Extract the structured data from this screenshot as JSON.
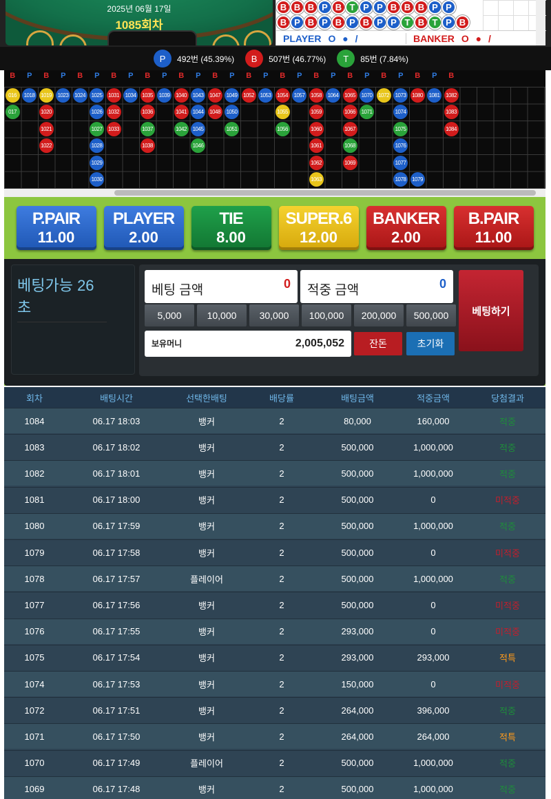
{
  "header": {
    "date": "2025년 06월 17일",
    "round": "1085회차"
  },
  "bead_road": {
    "row1": [
      "B",
      "B",
      "B",
      "P",
      "B",
      "T",
      "P",
      "P",
      "B",
      "B",
      "B",
      "P",
      "P"
    ],
    "row2": [
      "B",
      "P",
      "B",
      "P",
      "B",
      "P",
      "B",
      "P",
      "P",
      "T",
      "B",
      "T",
      "P",
      "B"
    ],
    "player_label": "PLAYER",
    "banker_label": "BANKER",
    "player_symbols": "O ● /",
    "banker_symbols": "O ● /"
  },
  "stats": {
    "player": {
      "icon": "P",
      "text": "492번 (45.39%)"
    },
    "banker": {
      "icon": "B",
      "text": "507번 (46.77%)"
    },
    "tie": {
      "icon": "T",
      "text": "85번 (7.84%)"
    }
  },
  "roadmap": {
    "header": [
      "B",
      "P",
      "B",
      "P",
      "B",
      "P",
      "B",
      "P",
      "B",
      "P",
      "B",
      "P",
      "B",
      "P",
      "B",
      "P",
      "B",
      "P",
      "B",
      "P",
      "B",
      "P",
      "B",
      "P",
      "B",
      "P",
      "B"
    ],
    "cells": [
      {
        "c": 0,
        "r": 0,
        "t": "Y",
        "n": "016"
      },
      {
        "c": 1,
        "r": 0,
        "t": "P",
        "n": "1018"
      },
      {
        "c": 2,
        "r": 0,
        "t": "Y",
        "n": "1019"
      },
      {
        "c": 3,
        "r": 0,
        "t": "P",
        "n": "1023"
      },
      {
        "c": 4,
        "r": 0,
        "t": "P",
        "n": "1024"
      },
      {
        "c": 5,
        "r": 0,
        "t": "P",
        "n": "1025"
      },
      {
        "c": 6,
        "r": 0,
        "t": "B",
        "n": "1031"
      },
      {
        "c": 7,
        "r": 0,
        "t": "P",
        "n": "1034"
      },
      {
        "c": 8,
        "r": 0,
        "t": "B",
        "n": "1035"
      },
      {
        "c": 9,
        "r": 0,
        "t": "P",
        "n": "1039"
      },
      {
        "c": 10,
        "r": 0,
        "t": "B",
        "n": "1040"
      },
      {
        "c": 11,
        "r": 0,
        "t": "P",
        "n": "1043"
      },
      {
        "c": 12,
        "r": 0,
        "t": "B",
        "n": "1047"
      },
      {
        "c": 13,
        "r": 0,
        "t": "P",
        "n": "1049"
      },
      {
        "c": 14,
        "r": 0,
        "t": "B",
        "n": "1052"
      },
      {
        "c": 15,
        "r": 0,
        "t": "P",
        "n": "1053"
      },
      {
        "c": 16,
        "r": 0,
        "t": "B",
        "n": "1054"
      },
      {
        "c": 17,
        "r": 0,
        "t": "P",
        "n": "1057"
      },
      {
        "c": 18,
        "r": 0,
        "t": "B",
        "n": "1058"
      },
      {
        "c": 19,
        "r": 0,
        "t": "P",
        "n": "1064"
      },
      {
        "c": 20,
        "r": 0,
        "t": "B",
        "n": "1065"
      },
      {
        "c": 21,
        "r": 0,
        "t": "P",
        "n": "1070"
      },
      {
        "c": 22,
        "r": 0,
        "t": "Y",
        "n": "1072"
      },
      {
        "c": 23,
        "r": 0,
        "t": "P",
        "n": "1073"
      },
      {
        "c": 24,
        "r": 0,
        "t": "B",
        "n": "1080"
      },
      {
        "c": 25,
        "r": 0,
        "t": "P",
        "n": "1081"
      },
      {
        "c": 26,
        "r": 0,
        "t": "B",
        "n": "1082"
      },
      {
        "c": 0,
        "r": 1,
        "t": "T",
        "n": "017"
      },
      {
        "c": 2,
        "r": 1,
        "t": "B",
        "n": "1020"
      },
      {
        "c": 5,
        "r": 1,
        "t": "P",
        "n": "1026"
      },
      {
        "c": 6,
        "r": 1,
        "t": "B",
        "n": "1032"
      },
      {
        "c": 8,
        "r": 1,
        "t": "B",
        "n": "1036"
      },
      {
        "c": 10,
        "r": 1,
        "t": "B",
        "n": "1041"
      },
      {
        "c": 11,
        "r": 1,
        "t": "P",
        "n": "1044"
      },
      {
        "c": 12,
        "r": 1,
        "t": "B",
        "n": "1048"
      },
      {
        "c": 13,
        "r": 1,
        "t": "P",
        "n": "1050"
      },
      {
        "c": 16,
        "r": 1,
        "t": "Y",
        "n": "1055"
      },
      {
        "c": 18,
        "r": 1,
        "t": "B",
        "n": "1059"
      },
      {
        "c": 20,
        "r": 1,
        "t": "B",
        "n": "1066"
      },
      {
        "c": 21,
        "r": 1,
        "t": "T",
        "n": "1071"
      },
      {
        "c": 23,
        "r": 1,
        "t": "P",
        "n": "1074"
      },
      {
        "c": 26,
        "r": 1,
        "t": "B",
        "n": "1083"
      },
      {
        "c": 2,
        "r": 2,
        "t": "B",
        "n": "1021"
      },
      {
        "c": 5,
        "r": 2,
        "t": "T",
        "n": "1027"
      },
      {
        "c": 6,
        "r": 2,
        "t": "B",
        "n": "1033"
      },
      {
        "c": 8,
        "r": 2,
        "t": "T",
        "n": "1037"
      },
      {
        "c": 10,
        "r": 2,
        "t": "T",
        "n": "1042"
      },
      {
        "c": 11,
        "r": 2,
        "t": "P",
        "n": "1045"
      },
      {
        "c": 13,
        "r": 2,
        "t": "T",
        "n": "1051"
      },
      {
        "c": 16,
        "r": 2,
        "t": "T",
        "n": "1056"
      },
      {
        "c": 18,
        "r": 2,
        "t": "B",
        "n": "1060"
      },
      {
        "c": 20,
        "r": 2,
        "t": "B",
        "n": "1067"
      },
      {
        "c": 23,
        "r": 2,
        "t": "T",
        "n": "1075"
      },
      {
        "c": 26,
        "r": 2,
        "t": "B",
        "n": "1084"
      },
      {
        "c": 2,
        "r": 3,
        "t": "B",
        "n": "1022"
      },
      {
        "c": 5,
        "r": 3,
        "t": "P",
        "n": "1028"
      },
      {
        "c": 8,
        "r": 3,
        "t": "B",
        "n": "1038"
      },
      {
        "c": 11,
        "r": 3,
        "t": "T",
        "n": "1046"
      },
      {
        "c": 18,
        "r": 3,
        "t": "B",
        "n": "1061"
      },
      {
        "c": 20,
        "r": 3,
        "t": "T",
        "n": "1068"
      },
      {
        "c": 23,
        "r": 3,
        "t": "P",
        "n": "1076"
      },
      {
        "c": 5,
        "r": 4,
        "t": "P",
        "n": "1029"
      },
      {
        "c": 18,
        "r": 4,
        "t": "B",
        "n": "1062"
      },
      {
        "c": 20,
        "r": 4,
        "t": "B",
        "n": "1069"
      },
      {
        "c": 23,
        "r": 4,
        "t": "P",
        "n": "1077"
      },
      {
        "c": 5,
        "r": 5,
        "t": "P",
        "n": "1030"
      },
      {
        "c": 18,
        "r": 5,
        "t": "Y",
        "n": "1063"
      },
      {
        "c": 23,
        "r": 5,
        "t": "P",
        "n": "1078"
      },
      {
        "c": 24,
        "r": 5,
        "t": "P",
        "n": "1079"
      }
    ]
  },
  "bet_options": [
    {
      "name": "P.PAIR",
      "odds": "11.00",
      "color": "blue"
    },
    {
      "name": "PLAYER",
      "odds": "2.00",
      "color": "blue"
    },
    {
      "name": "TIE",
      "odds": "8.00",
      "color": "green"
    },
    {
      "name": "SUPER.6",
      "odds": "12.00",
      "color": "yellow"
    },
    {
      "name": "BANKER",
      "odds": "2.00",
      "color": "red"
    },
    {
      "name": "B.PAIR",
      "odds": "11.00",
      "color": "red"
    }
  ],
  "betting": {
    "timer": "베팅가능 26초",
    "bet_amount_label": "베팅 금액",
    "bet_amount_value": "0",
    "win_amount_label": "적중 금액",
    "win_amount_value": "0",
    "chips": [
      "5,000",
      "10,000",
      "30,000",
      "100,000",
      "200,000",
      "500,000"
    ],
    "balance_label": "보유머니",
    "balance_value": "2,005,052",
    "small_change_label": "잔돈",
    "reset_label": "초기화",
    "bet_button_label": "베팅하기"
  },
  "history": {
    "headers": [
      "회차",
      "배팅시간",
      "선택한배팅",
      "배당률",
      "배팅금액",
      "적중금액",
      "당첨결과"
    ],
    "rows": [
      [
        "1084",
        "06.17 18:03",
        "뱅커",
        "2",
        "80,000",
        "160,000",
        "적중",
        "ok"
      ],
      [
        "1083",
        "06.17 18:02",
        "뱅커",
        "2",
        "500,000",
        "1,000,000",
        "적중",
        "ok"
      ],
      [
        "1082",
        "06.17 18:01",
        "뱅커",
        "2",
        "500,000",
        "1,000,000",
        "적중",
        "ok"
      ],
      [
        "1081",
        "06.17 18:00",
        "뱅커",
        "2",
        "500,000",
        "0",
        "미적중",
        "miss"
      ],
      [
        "1080",
        "06.17 17:59",
        "뱅커",
        "2",
        "500,000",
        "1,000,000",
        "적중",
        "ok"
      ],
      [
        "1079",
        "06.17 17:58",
        "뱅커",
        "2",
        "500,000",
        "0",
        "미적중",
        "miss"
      ],
      [
        "1078",
        "06.17 17:57",
        "플레이어",
        "2",
        "500,000",
        "1,000,000",
        "적중",
        "ok"
      ],
      [
        "1077",
        "06.17 17:56",
        "뱅커",
        "2",
        "500,000",
        "0",
        "미적중",
        "miss"
      ],
      [
        "1076",
        "06.17 17:55",
        "뱅커",
        "2",
        "293,000",
        "0",
        "미적중",
        "miss"
      ],
      [
        "1075",
        "06.17 17:54",
        "뱅커",
        "2",
        "293,000",
        "293,000",
        "적특",
        "spec"
      ],
      [
        "1074",
        "06.17 17:53",
        "뱅커",
        "2",
        "150,000",
        "0",
        "미적중",
        "miss"
      ],
      [
        "1072",
        "06.17 17:51",
        "뱅커",
        "2",
        "264,000",
        "396,000",
        "적중",
        "ok"
      ],
      [
        "1071",
        "06.17 17:50",
        "뱅커",
        "2",
        "264,000",
        "264,000",
        "적특",
        "spec"
      ],
      [
        "1070",
        "06.17 17:49",
        "플레이어",
        "2",
        "500,000",
        "1,000,000",
        "적중",
        "ok"
      ],
      [
        "1069",
        "06.17 17:48",
        "뱅커",
        "2",
        "500,000",
        "1,000,000",
        "적중",
        "ok"
      ]
    ]
  }
}
